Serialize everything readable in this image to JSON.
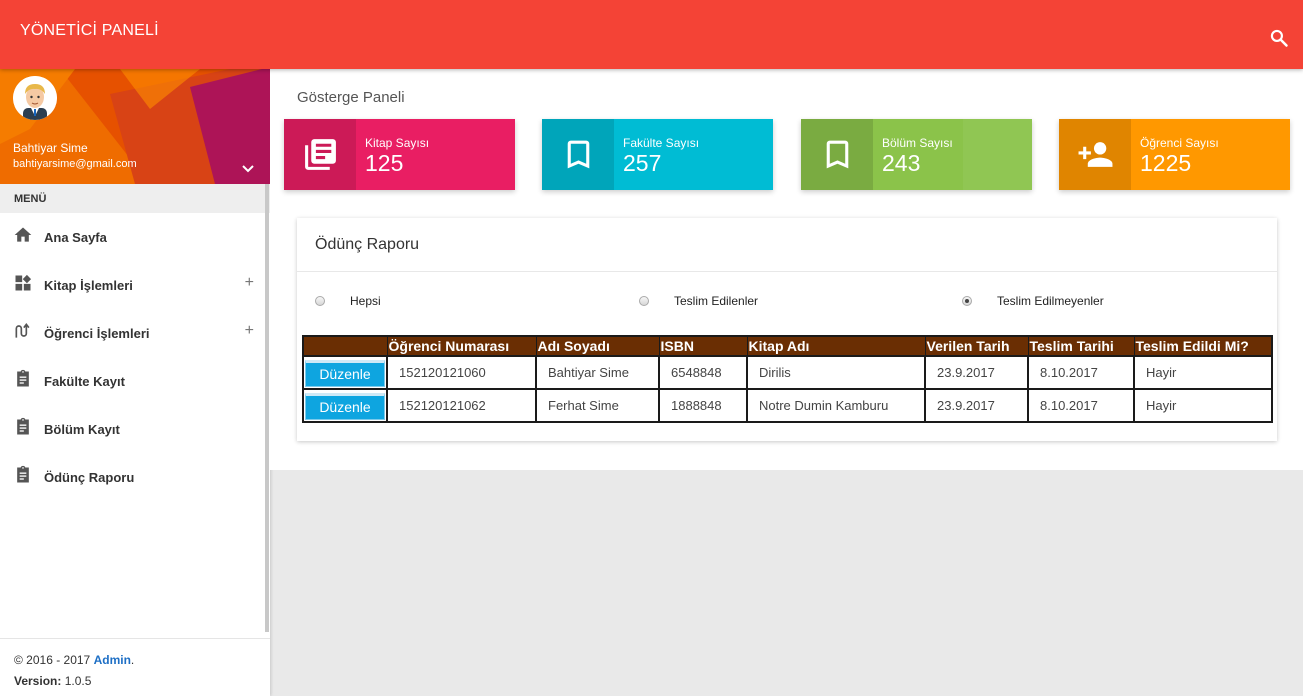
{
  "header": {
    "brand": "YÖNETİCİ PANELİ",
    "search_icon": "search-icon"
  },
  "sidebar": {
    "user": {
      "name": "Bahtiyar Sime",
      "email": "bahtiyarsime@gmail.com"
    },
    "menu_header": "MENÜ",
    "items": [
      {
        "label": "Ana Sayfa",
        "icon": "home-icon",
        "has_submenu": false
      },
      {
        "label": "Kitap İşlemleri",
        "icon": "widgets-icon",
        "has_submenu": true
      },
      {
        "label": "Öğrenci İşlemleri",
        "icon": "swap-icon",
        "has_submenu": true
      },
      {
        "label": "Fakülte Kayıt",
        "icon": "clipboard-icon",
        "has_submenu": false
      },
      {
        "label": "Bölüm Kayıt",
        "icon": "clipboard-icon",
        "has_submenu": false
      },
      {
        "label": "Ödünç Raporu",
        "icon": "clipboard-icon",
        "has_submenu": false
      }
    ],
    "plus_symbol": "+",
    "footer": {
      "copyright_prefix": "© 2016 - 2017 ",
      "copyright_link": "Admin",
      "copyright_suffix": ".",
      "version_label": "Version:",
      "version_value": " 1.0.5"
    }
  },
  "main": {
    "page_title": "Gösterge Paneli",
    "info_boxes": [
      {
        "label": "Kitap Sayısı",
        "value": "125",
        "color": "#e91e63",
        "icon": "library-books-icon"
      },
      {
        "label": "Fakülte Sayısı",
        "value": "257",
        "color": "#00bcd4",
        "icon": "bookmark-icon"
      },
      {
        "label": "Bölüm Sayısı",
        "value": "243",
        "color": "#8bc34a",
        "icon": "bookmark-icon"
      },
      {
        "label": "Öğrenci Sayısı",
        "value": "1225",
        "color": "#ff9800",
        "icon": "person-add-icon"
      }
    ],
    "report": {
      "title": "Ödünç Raporu",
      "filters": [
        {
          "label": "Hepsi",
          "checked": false
        },
        {
          "label": "Teslim Edilenler",
          "checked": false
        },
        {
          "label": "Teslim Edilmeyenler",
          "checked": true
        }
      ],
      "columns": [
        "",
        "Öğrenci Numarası",
        "Adı Soyadı",
        "ISBN",
        "Kitap Adı",
        "Verilen Tarih",
        "Teslim Tarihi",
        "Teslim Edildi Mi?"
      ],
      "edit_label": "Düzenle",
      "rows": [
        [
          "152120121060",
          "Bahtiyar Sime",
          "6548848",
          "Dirilis",
          "23.9.2017",
          "8.10.2017",
          "Hayir"
        ],
        [
          "152120121062",
          "Ferhat Sime",
          "1888848",
          "Notre Dumin Kamburu",
          "23.9.2017",
          "8.10.2017",
          "Hayir"
        ]
      ]
    }
  }
}
